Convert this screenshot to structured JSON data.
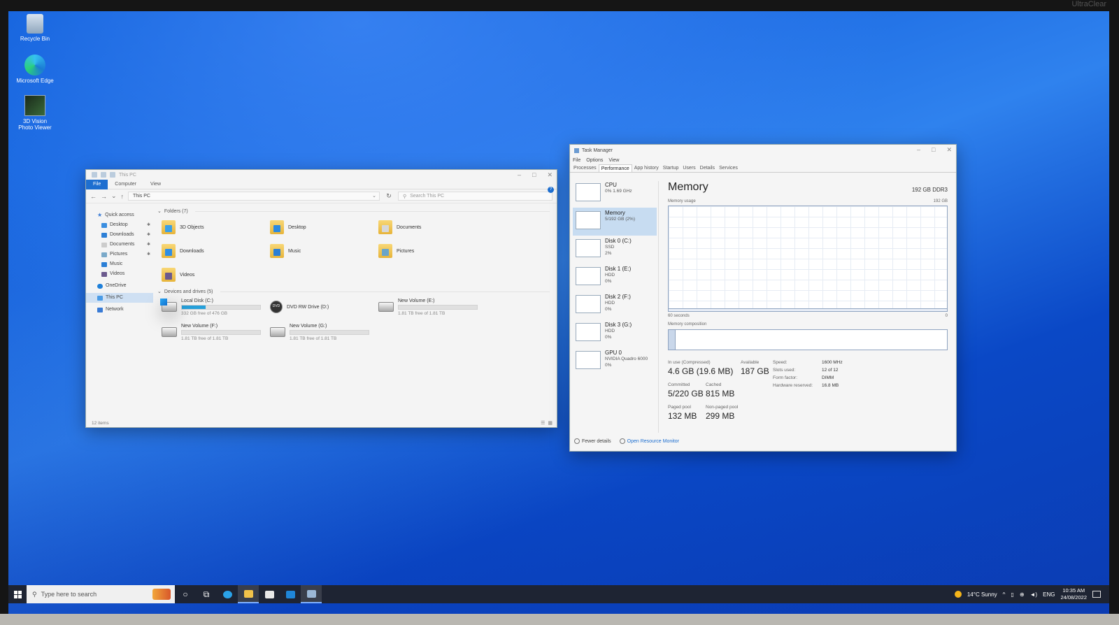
{
  "monitor": {
    "brand": "UltraClear"
  },
  "desktop": {
    "icons": [
      {
        "label": "Recycle Bin"
      },
      {
        "label": "Microsoft Edge"
      },
      {
        "label": "3D Vision Photo Viewer"
      }
    ]
  },
  "explorer": {
    "title": "This PC",
    "ribbon_tabs": [
      "File",
      "Computer",
      "View"
    ],
    "breadcrumb": "This PC",
    "search_placeholder": "Search This PC",
    "nav": [
      {
        "label": "Quick access"
      },
      {
        "label": "Desktop"
      },
      {
        "label": "Downloads"
      },
      {
        "label": "Documents"
      },
      {
        "label": "Pictures"
      },
      {
        "label": "Music"
      },
      {
        "label": "Videos"
      },
      {
        "label": "OneDrive"
      },
      {
        "label": "This PC"
      },
      {
        "label": "Network"
      }
    ],
    "folders_header": "Folders (7)",
    "folders": [
      {
        "name": "3D Objects",
        "accent": "#3aa0e8"
      },
      {
        "name": "Desktop",
        "accent": "#2c8ae0"
      },
      {
        "name": "Documents",
        "accent": "#d8d8d8"
      },
      {
        "name": "Downloads",
        "accent": "#2d8ee6"
      },
      {
        "name": "Music",
        "accent": "#2b7fd6"
      },
      {
        "name": "Pictures",
        "accent": "#6aa5c9"
      },
      {
        "name": "Videos",
        "accent": "#6b5a8e"
      }
    ],
    "drives_header": "Devices and drives (5)",
    "drives": [
      {
        "name": "Local Disk (C:)",
        "free": "332 GB free of 476 GB",
        "used_fraction": 0.3,
        "type": "system"
      },
      {
        "name": "DVD RW Drive (D:)",
        "free": "",
        "used_fraction": null,
        "type": "dvd"
      },
      {
        "name": "New Volume (E:)",
        "free": "1.81 TB free of 1.81 TB",
        "used_fraction": 0.0,
        "type": "hdd"
      },
      {
        "name": "New Volume (F:)",
        "free": "1.81 TB free of 1.81 TB",
        "used_fraction": 0.0,
        "type": "hdd"
      },
      {
        "name": "New Volume (G:)",
        "free": "1.81 TB free of 1.81 TB",
        "used_fraction": 0.0,
        "type": "hdd"
      }
    ],
    "status": "12 items"
  },
  "taskmgr": {
    "title": "Task Manager",
    "menu": [
      "File",
      "Options",
      "View"
    ],
    "tabs": [
      "Processes",
      "Performance",
      "App history",
      "Startup",
      "Users",
      "Details",
      "Services"
    ],
    "active_tab": "Performance",
    "resources": [
      {
        "name": "CPU",
        "line1": "0%  1.69 GHz",
        "line2": ""
      },
      {
        "name": "Memory",
        "line1": "5/192 GB (2%)",
        "line2": ""
      },
      {
        "name": "Disk 0 (C:)",
        "line1": "SSD",
        "line2": "2%"
      },
      {
        "name": "Disk 1 (E:)",
        "line1": "HDD",
        "line2": "0%"
      },
      {
        "name": "Disk 2 (F:)",
        "line1": "HDD",
        "line2": "0%"
      },
      {
        "name": "Disk 3 (G:)",
        "line1": "HDD",
        "line2": "0%"
      },
      {
        "name": "GPU 0",
        "line1": "NVIDIA Quadro 6000",
        "line2": "0%"
      }
    ],
    "memory": {
      "heading": "Memory",
      "total_type": "192 GB DDR3",
      "usage_label": "Memory usage",
      "usage_max": "192 GB",
      "time_span": "60 seconds",
      "time_end": "0",
      "composition_label": "Memory composition",
      "used_fraction": 0.026,
      "stats": {
        "in_use_label": "In use (Compressed)",
        "in_use": "4.6 GB (19.6 MB)",
        "available_label": "Available",
        "available": "187 GB",
        "committed_label": "Committed",
        "committed": "5/220 GB",
        "cached_label": "Cached",
        "cached": "815 MB",
        "paged_label": "Paged pool",
        "paged": "132 MB",
        "nonpaged_label": "Non-paged pool",
        "nonpaged": "299 MB"
      },
      "details": [
        {
          "k": "Speed:",
          "v": "1600 MHz"
        },
        {
          "k": "Slots used:",
          "v": "12 of 12"
        },
        {
          "k": "Form factor:",
          "v": "DIMM"
        },
        {
          "k": "Hardware reserved:",
          "v": "16.8 MB"
        }
      ]
    },
    "footer": {
      "fewer_details": "Fewer details",
      "open_monitor": "Open Resource Monitor"
    }
  },
  "taskbar": {
    "search_placeholder": "Type here to search",
    "weather": "14°C  Sunny",
    "language": "ENG",
    "time": "10:35 AM",
    "date": "24/08/2022"
  },
  "colors": {
    "accent": "#1e6fd0",
    "taskbar": "#1e2433",
    "disk_bar": "#26a0da"
  }
}
